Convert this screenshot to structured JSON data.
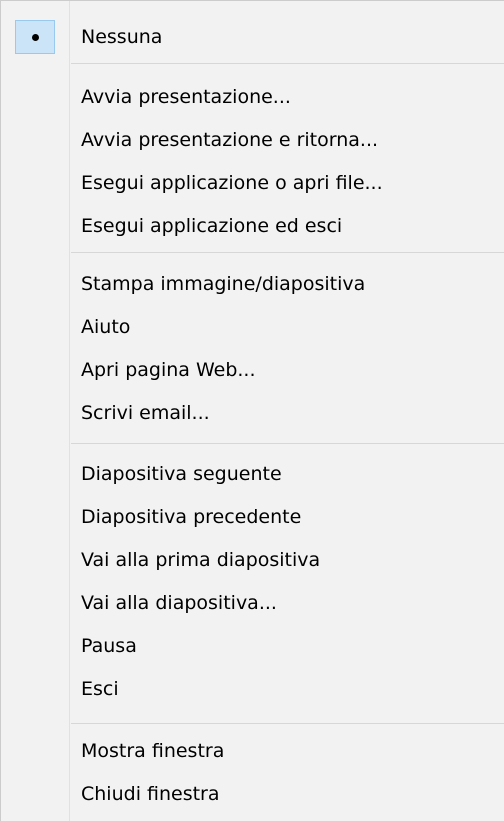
{
  "menu": {
    "items": [
      {
        "label": "Nessuna",
        "checked": true
      },
      {
        "label": "Avvia presentazione..."
      },
      {
        "label": "Avvia presentazione e ritorna..."
      },
      {
        "label": "Esegui applicazione o apri file..."
      },
      {
        "label": "Esegui applicazione ed esci"
      },
      {
        "label": "Stampa immagine/diapositiva"
      },
      {
        "label": "Aiuto"
      },
      {
        "label": "Apri pagina Web..."
      },
      {
        "label": "Scrivi email..."
      },
      {
        "label": "Diapositiva seguente"
      },
      {
        "label": "Diapositiva precedente"
      },
      {
        "label": "Vai alla prima diapositiva"
      },
      {
        "label": "Vai alla diapositiva..."
      },
      {
        "label": "Pausa"
      },
      {
        "label": "Esci"
      },
      {
        "label": "Mostra finestra"
      },
      {
        "label": "Chiudi finestra"
      }
    ],
    "icons": {
      "checked": "bullet-icon"
    },
    "colors": {
      "background": "#f2f2f2",
      "separator": "#d7d7d7",
      "check_highlight": "#cce4f7",
      "check_border": "#99c9ef"
    }
  }
}
